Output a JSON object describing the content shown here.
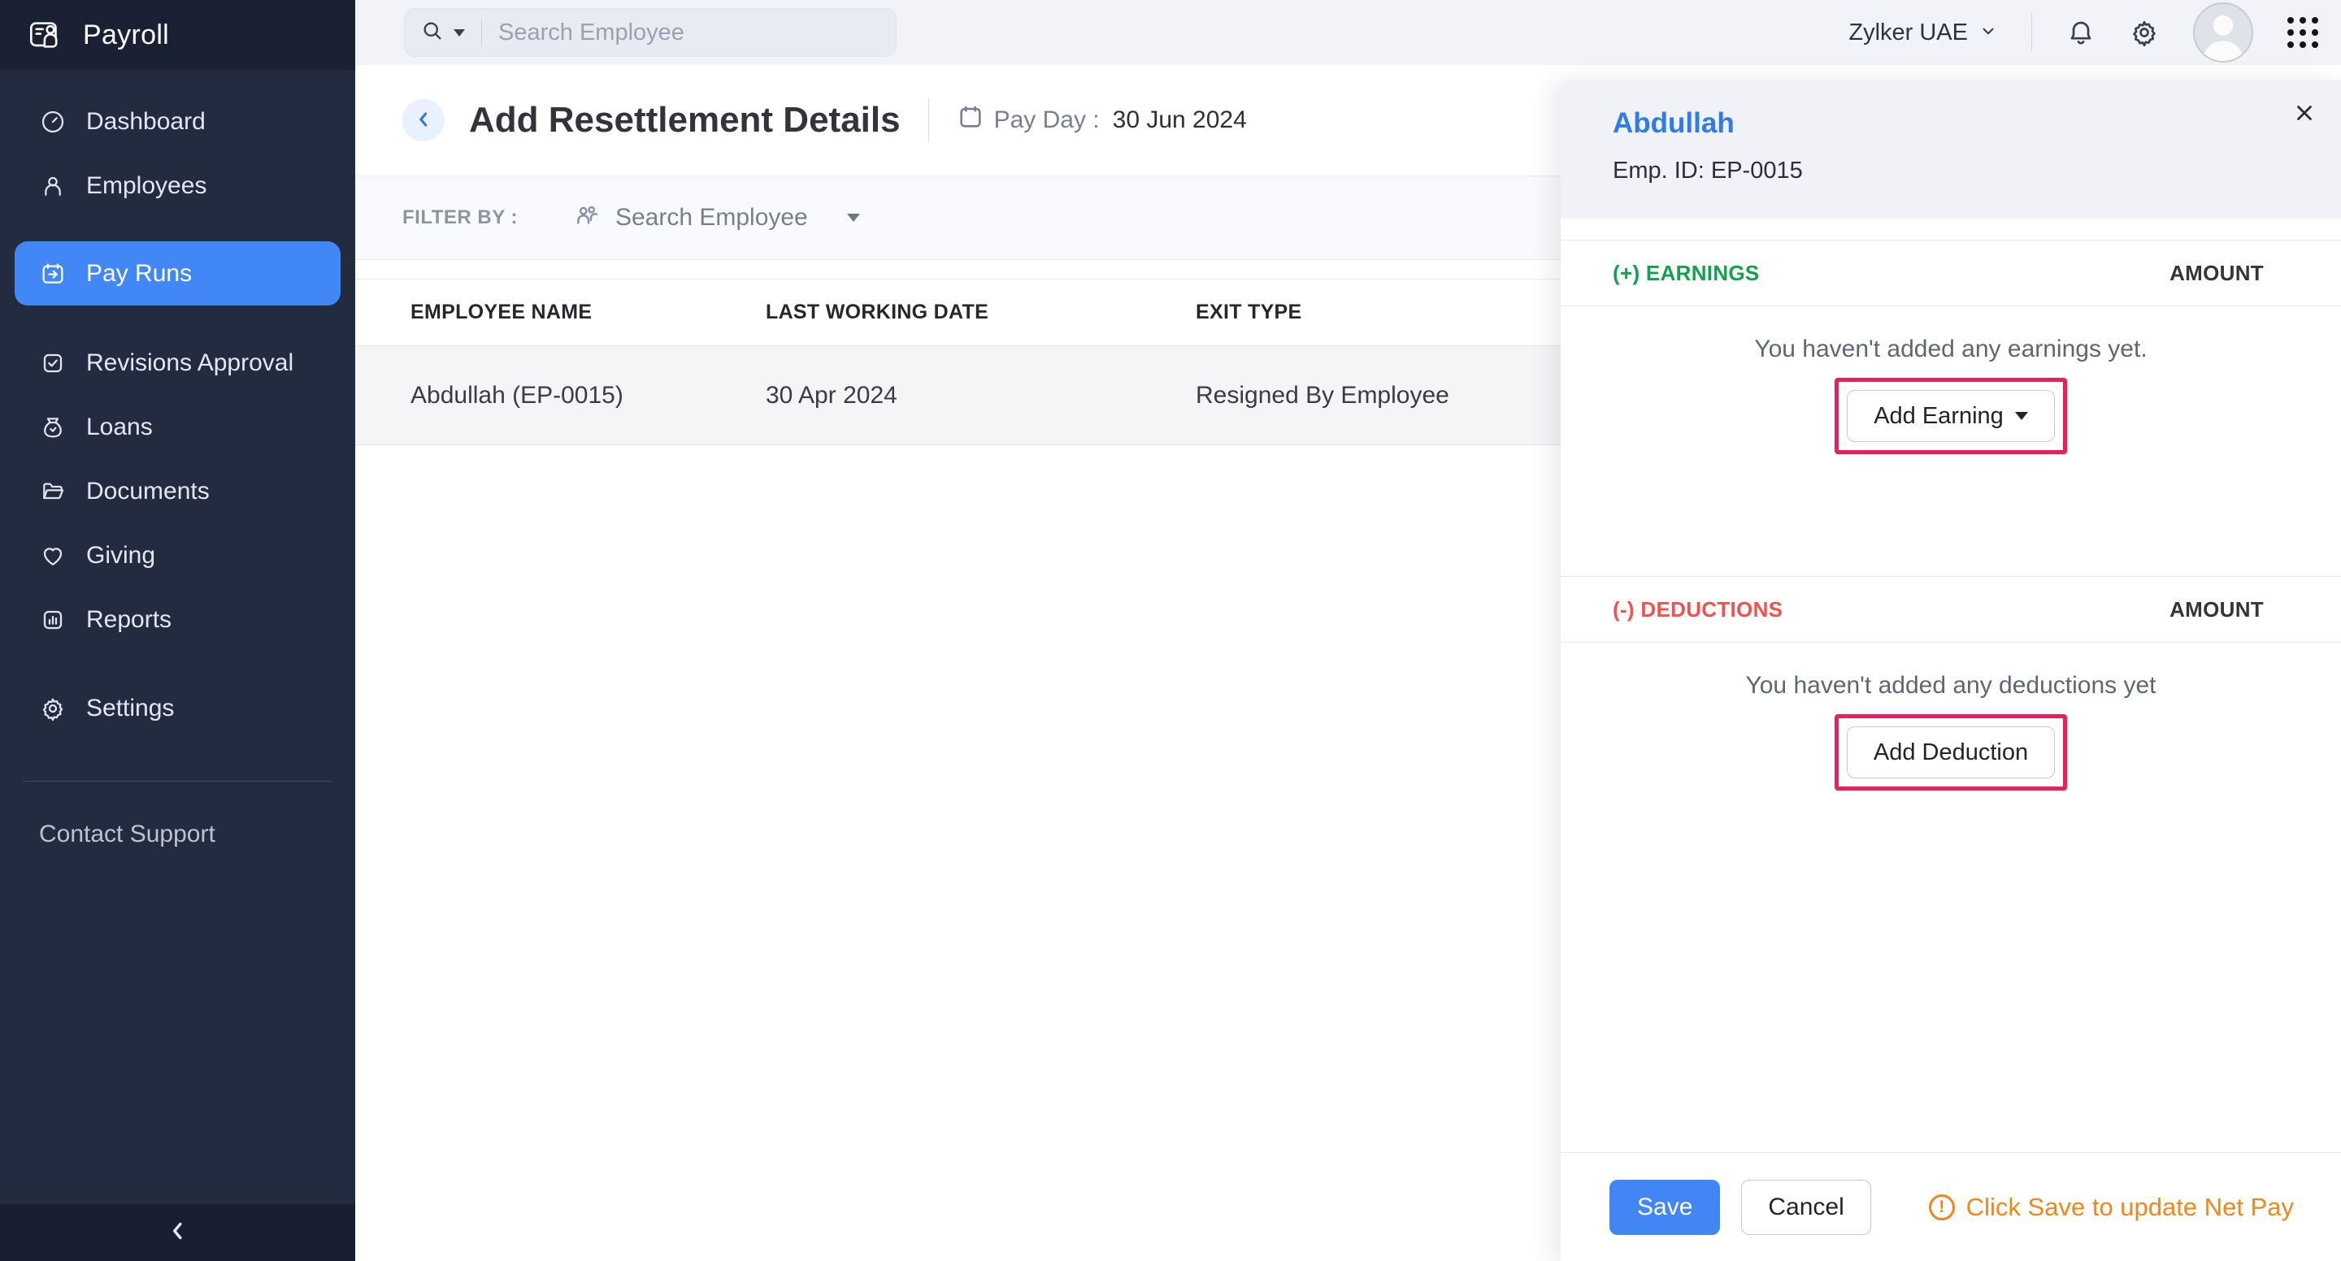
{
  "app": {
    "name": "Payroll"
  },
  "topbar": {
    "search_placeholder": "Search Employee",
    "org": "Zylker UAE"
  },
  "sidebar": {
    "items": [
      {
        "label": "Dashboard"
      },
      {
        "label": "Employees"
      },
      {
        "label": "Pay Runs"
      },
      {
        "label": "Revisions Approval"
      },
      {
        "label": "Loans"
      },
      {
        "label": "Documents"
      },
      {
        "label": "Giving"
      },
      {
        "label": "Reports"
      },
      {
        "label": "Settings"
      }
    ],
    "active_item": "Pay Runs",
    "support": "Contact Support"
  },
  "page": {
    "title": "Add Resettlement Details",
    "pay_day_label": "Pay Day :",
    "pay_day_value": "30 Jun 2024"
  },
  "filter": {
    "label": "FILTER BY :",
    "employee_placeholder": "Search Employee"
  },
  "table": {
    "columns": [
      "EMPLOYEE NAME",
      "LAST WORKING DATE",
      "EXIT TYPE"
    ],
    "rows": [
      {
        "employee": "Abdullah (EP-0015)",
        "last_working_date": "30 Apr 2024",
        "exit_type": "Resigned By Employee"
      }
    ]
  },
  "panel": {
    "employee_name": "Abdullah",
    "employee_id": "Emp. ID: EP-0015",
    "earnings": {
      "header": "(+) EARNINGS",
      "amount_label": "AMOUNT",
      "empty": "You haven't added any earnings yet.",
      "button": "Add Earning"
    },
    "deductions": {
      "header": "(-) DEDUCTIONS",
      "amount_label": "AMOUNT",
      "empty": "You haven't added any deductions yet",
      "button": "Add Deduction"
    },
    "footer": {
      "save": "Save",
      "cancel": "Cancel",
      "warning": "Click Save to update Net Pay"
    }
  },
  "colors": {
    "accent_blue": "#4285F4",
    "link_blue": "#2F7BEC",
    "earnings_green": "#12A24B",
    "deductions_red": "#F4514E",
    "warning_orange": "#F1861B",
    "highlight_pink": "#EE1D5C",
    "sidebar_bg": "#232B40"
  }
}
